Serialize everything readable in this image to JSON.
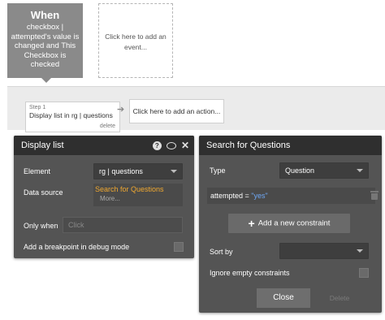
{
  "event": {
    "title": "When",
    "description": "checkbox | attempted's value is changed and This Checkbox is checked"
  },
  "add_event": {
    "label": "Click here to add an event..."
  },
  "step": {
    "number": "Step 1",
    "text": "Display list in rg | questions",
    "delete_label": "delete"
  },
  "add_action": {
    "label": "Click here to add an action..."
  },
  "display_list": {
    "title": "Display list",
    "element_label": "Element",
    "element_value": "rg | questions",
    "data_source_label": "Data source",
    "data_source_expr": "Search for Questions",
    "data_source_more": "More...",
    "only_when_label": "Only when",
    "only_when_placeholder": "Click",
    "breakpoint_label": "Add a breakpoint in debug mode",
    "icons": [
      "help-icon",
      "comment-icon",
      "close-icon"
    ]
  },
  "search": {
    "title": "Search for Questions",
    "type_label": "Type",
    "type_value": "Question",
    "constraint_field": "attempted = ",
    "constraint_value": "\"yes\"",
    "add_constraint_label": "Add a new constraint",
    "sort_by_label": "Sort by",
    "sort_by_value": "",
    "ignore_empty_label": "Ignore empty constraints",
    "close_label": "Close",
    "delete_label": "Delete"
  }
}
